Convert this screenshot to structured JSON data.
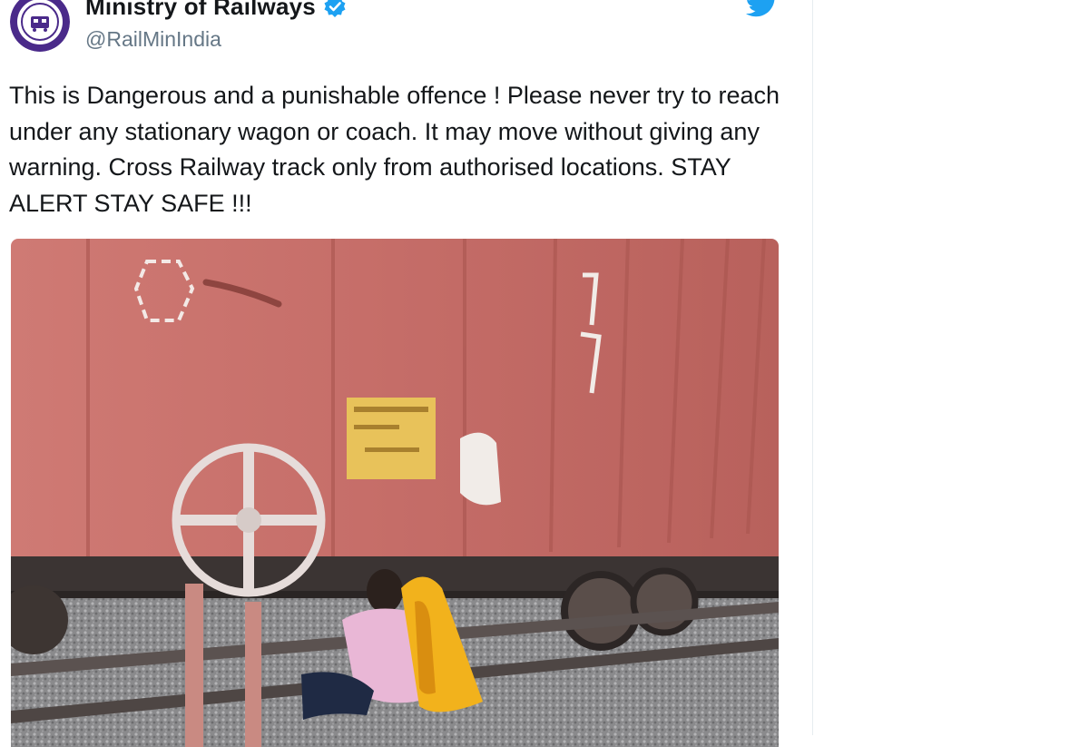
{
  "tweet": {
    "display_name": "Ministry of Railways",
    "handle": "@RailMinIndia",
    "text": "This is Dangerous and a punishable offence ! Please never try to reach under any stationary wagon or coach. It may move without giving any warning. Cross Railway track only from authorised locations. STAY ALERT STAY SAFE !!!",
    "verified": true
  },
  "icons": {
    "avatar": "railways-logo-avatar",
    "verified": "verified-badge-icon",
    "brand": "twitter-bird-icon"
  },
  "colors": {
    "brand_blue": "#1da1f2",
    "avatar_purple": "#4a2a8a",
    "wagon_red": "#c86e6a"
  }
}
